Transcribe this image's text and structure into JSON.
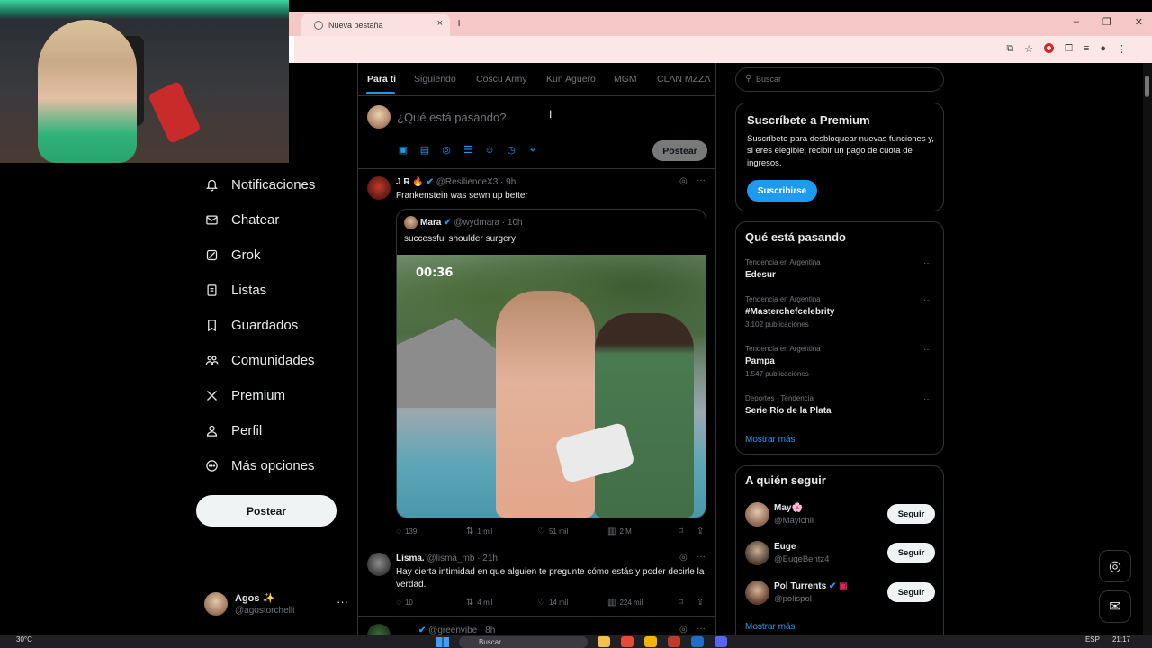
{
  "browser": {
    "tab_title": "Nueva pestaña",
    "tab_close": "×",
    "new_tab": "+",
    "window_controls": [
      "–",
      "❐",
      "✕"
    ]
  },
  "nav": {
    "items": [
      {
        "label": "Notificaciones",
        "icon": "bell-icon"
      },
      {
        "label": "Chatear",
        "icon": "mail-icon"
      },
      {
        "label": "Grok",
        "icon": "grok-icon"
      },
      {
        "label": "Listas",
        "icon": "list-icon"
      },
      {
        "label": "Guardados",
        "icon": "bookmark-icon"
      },
      {
        "label": "Comunidades",
        "icon": "communities-icon"
      },
      {
        "label": "Premium",
        "icon": "x-logo-icon"
      },
      {
        "label": "Perfil",
        "icon": "person-icon"
      },
      {
        "label": "Más opciones",
        "icon": "more-circle-icon"
      }
    ],
    "post_button": "Postear",
    "account": {
      "name": "Agos ✨",
      "handle": "@agostorchelli",
      "more": "···"
    }
  },
  "feed": {
    "tabs": [
      "Para ti",
      "Siguiendo",
      "Coscu Army",
      "Kun Agüero",
      "MGM",
      "CLΛN MZZΛ"
    ],
    "composer": {
      "placeholder": "¿Qué está pasando?",
      "post_button": "Postear"
    },
    "tweets": [
      {
        "name": "J R 🔥",
        "handle": "@ResilienceX3 · 9h",
        "text": "Frankenstein was sewn up better",
        "quote": {
          "name": "Mara",
          "handle": "@wydmara · 10h",
          "text": "successful shoulder surgery",
          "video_time": "00:36"
        },
        "replies": "139",
        "reposts": "1 mil",
        "likes": "51 mil",
        "views": "2 M"
      },
      {
        "name": "Lisma.",
        "handle": "@lisma_mb · 21h",
        "text": "Hay cierta intimidad en que alguien te pregunte cómo estás y poder decirle la verdad.",
        "replies": "10",
        "reposts": "4 mil",
        "likes": "14 mil",
        "views": "224 mil"
      },
      {
        "handle": "@greenvibe · 8h"
      }
    ]
  },
  "right": {
    "search_placeholder": "Buscar",
    "premium": {
      "title": "Suscríbete a Premium",
      "body": "Suscríbete para desbloquear nuevas funciones y, si eres elegible, recibir un pago de cuota de ingresos.",
      "button": "Suscribirse"
    },
    "trends": {
      "title": "Qué está pasando",
      "items": [
        {
          "context": "Tendencia en Argentina",
          "name": "Edesur",
          "count": ""
        },
        {
          "context": "Tendencia en Argentina",
          "name": "#Masterchefcelebrity",
          "count": "3.102 publicaciones"
        },
        {
          "context": "Tendencia en Argentina",
          "name": "Pampa",
          "count": "1.547 publicaciones"
        },
        {
          "context": "Deportes · Tendencia",
          "name": "Serie Río de la Plata",
          "count": ""
        }
      ],
      "more": "Mostrar más"
    },
    "follow": {
      "title": "A quién seguir",
      "items": [
        {
          "name": "May🌸",
          "handle": "@Mayichil",
          "button": "Seguir"
        },
        {
          "name": "Euge",
          "handle": "@EugeBentz4",
          "button": "Seguir"
        },
        {
          "name": "Pol Turrents",
          "handle": "@polispol",
          "button": "Seguir"
        }
      ],
      "more": "Mostrar más"
    }
  },
  "taskbar": {
    "weather": "30°C",
    "search": "Buscar",
    "lang": "ESP",
    "time": "21:17"
  },
  "colors": {
    "accent": "#1d9bf0",
    "background": "#000000",
    "border": "#2f3336",
    "muted": "#71767b"
  }
}
